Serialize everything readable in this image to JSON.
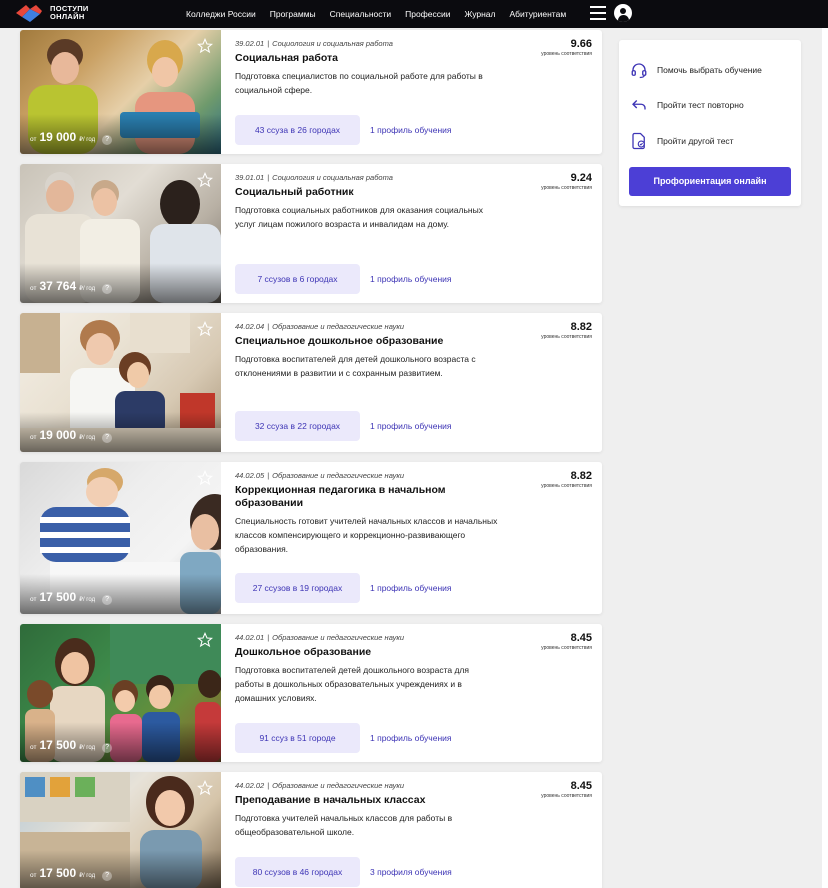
{
  "header": {
    "logo_line1": "ПОСТУПИ",
    "logo_line2": "ОНЛАЙН",
    "nav": [
      "Колледжи России",
      "Программы",
      "Специальности",
      "Профессии",
      "Журнал",
      "Абитуриентам"
    ]
  },
  "cards": [
    {
      "code": "39.02.01",
      "field": "Социология и социальная работа",
      "title": "Социальная работа",
      "description": "Подготовка специалистов по социальной работе для работы в социальной сфере.",
      "score": "9.66",
      "score_label": "уровень соответствия",
      "price_from": "от",
      "price": "19 000",
      "price_unit": "₽/ год",
      "help": "?",
      "schools": "43 ссуза в  26 городах",
      "profiles": "1 профиль обучения"
    },
    {
      "code": "39.01.01",
      "field": "Социология и социальная работа",
      "title": "Социальный работник",
      "description": "Подготовка социальных работников для оказания социальных услуг лицам пожилого возраста и инвалидам на дому.",
      "score": "9.24",
      "score_label": "уровень соответствия",
      "price_from": "от",
      "price": "37 764",
      "price_unit": "₽/ год",
      "help": "?",
      "schools": "7 ссузов в  6 городах",
      "profiles": "1 профиль обучения"
    },
    {
      "code": "44.02.04",
      "field": "Образование и педагогические науки",
      "title": "Специальное дошкольное образование",
      "description": "Подготовка воспитателей для детей дошкольного возраста с отклонениями в развитии и с сохранным развитием.",
      "score": "8.82",
      "score_label": "уровень соответствия",
      "price_from": "от",
      "price": "19 000",
      "price_unit": "₽/ год",
      "help": "?",
      "schools": "32 ссуза в  22 городах",
      "profiles": "1 профиль обучения"
    },
    {
      "code": "44.02.05",
      "field": "Образование и педагогические науки",
      "title": "Коррекционная педагогика в начальном образовании",
      "description": "Специальность готовит учителей начальных классов и начальных классов компенсирующего и коррекционно-развивающего образования.",
      "score": "8.82",
      "score_label": "уровень соответствия",
      "price_from": "от",
      "price": "17 500",
      "price_unit": "₽/ год",
      "help": "?",
      "schools": "27 ссузов в  19 городах",
      "profiles": "1 профиль обучения"
    },
    {
      "code": "44.02.01",
      "field": "Образование и педагогические науки",
      "title": "Дошкольное образование",
      "description": "Подготовка воспитателей детей дошкольного возраста для работы в дошкольных образовательных учреждениях и в домашних условиях.",
      "score": "8.45",
      "score_label": "уровень соответствия",
      "price_from": "от",
      "price": "17 500",
      "price_unit": "₽/ год",
      "help": "?",
      "schools": "91 ссуз в  51 городе",
      "profiles": "1 профиль обучения"
    },
    {
      "code": "44.02.02",
      "field": "Образование и педагогические науки",
      "title": "Преподавание в начальных классах",
      "description": "Подготовка учителей начальных классов для работы в общеобразовательной школе.",
      "score": "8.45",
      "score_label": "уровень соответствия",
      "price_from": "от",
      "price": "17 500",
      "price_unit": "₽/ год",
      "help": "?",
      "schools": "80 ссузов в  46 городах",
      "profiles": "3 профиля обучения"
    }
  ],
  "side": {
    "help_choose": "Помочь выбрать обучение",
    "retake": "Пройти тест повторно",
    "other_test": "Пройти другой тест",
    "cta": "Профориентация онлайн"
  },
  "colors": {
    "accent": "#4c3fd6",
    "pill_bg": "#ebe9fb",
    "header_bg": "#0b0b0f"
  }
}
